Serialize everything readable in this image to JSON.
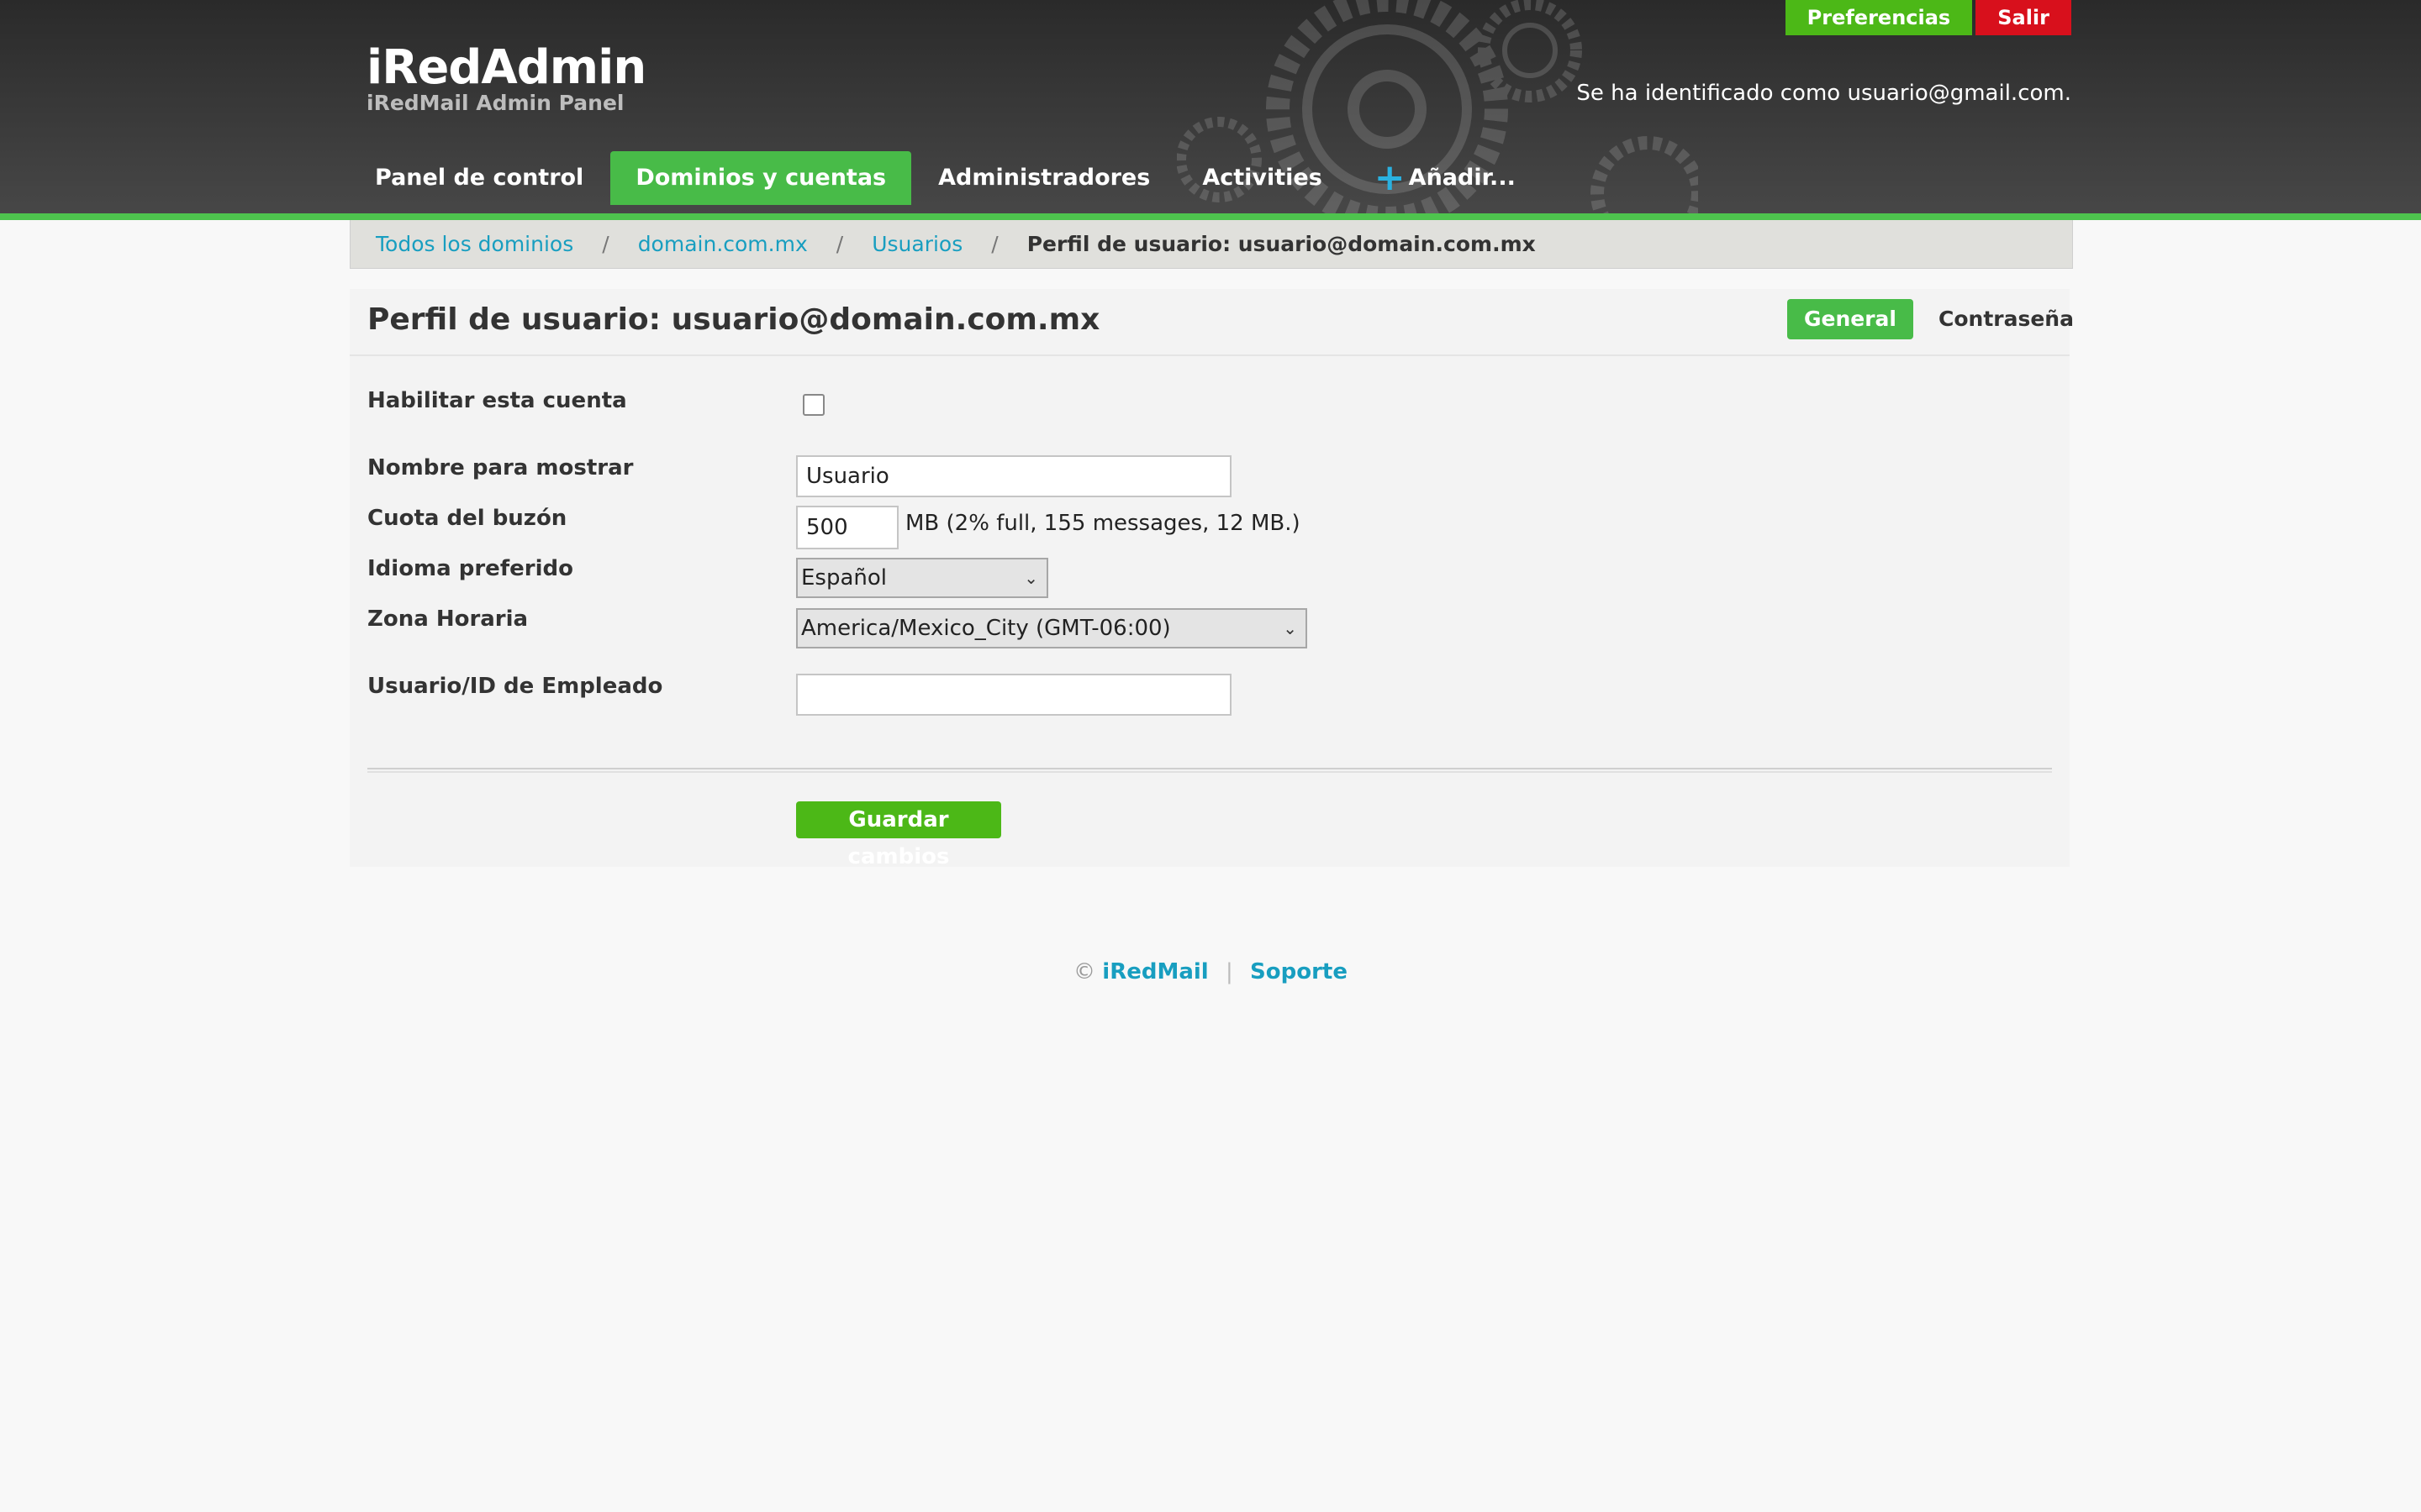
{
  "header": {
    "brand_title": "iRedAdmin",
    "brand_subtitle": "iRedMail Admin Panel",
    "top_links": {
      "preferences": "Preferencias",
      "logout": "Salir"
    },
    "logged_in_text": "Se ha identificado como usuario@gmail.com.",
    "nav": {
      "dashboard": "Panel de control",
      "domains_accounts": "Dominios y cuentas",
      "admins": "Administradores",
      "activities": "Activities",
      "add": "Añadir..."
    },
    "colors": {
      "accent_green": "#48bb48",
      "logout_red": "#d8101c",
      "link_blue": "#189ec0"
    }
  },
  "breadcrumb": {
    "all_domains": "Todos los dominios",
    "domain": "domain.com.mx",
    "users": "Usuarios",
    "current": "Perfil de usuario: usuario@domain.com.mx",
    "separator": "/"
  },
  "profile": {
    "title": "Perfil de usuario: usuario@domain.com.mx",
    "tabs": {
      "general": "General",
      "password": "Contraseña"
    },
    "fields": {
      "enable_label": "Habilitar esta cuenta",
      "enable_checked": false,
      "display_name_label": "Nombre para mostrar",
      "display_name_value": "Usuario",
      "quota_label": "Cuota del buzón",
      "quota_value": "500",
      "quota_note": "MB (2% full, 155 messages, 12 MB.)",
      "language_label": "Idioma preferido",
      "language_value": "Español",
      "timezone_label": "Zona Horaria",
      "timezone_value": "America/Mexico_City (GMT-06:00)",
      "employee_id_label": "Usuario/ID de Empleado",
      "employee_id_value": ""
    },
    "save_label": "Guardar cambios"
  },
  "footer": {
    "copyright": "©",
    "iredmail": "iRedMail",
    "separator": "|",
    "support": "Soporte"
  }
}
